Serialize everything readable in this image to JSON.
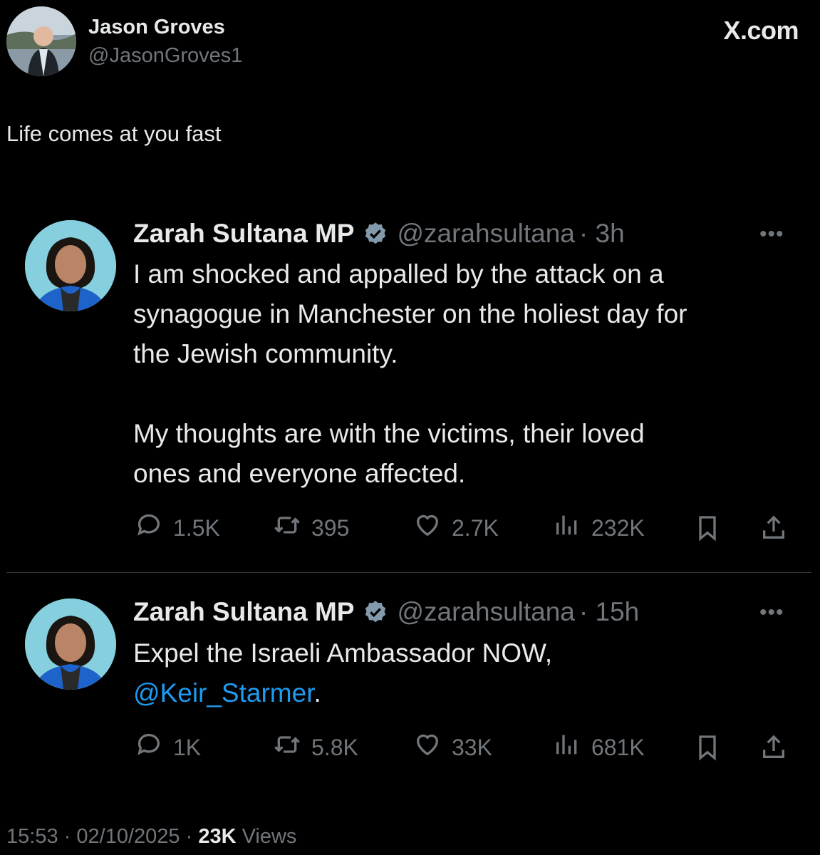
{
  "author": {
    "name": "Jason Groves",
    "handle": "@JasonGroves1"
  },
  "brand": "X.com",
  "post_text": "Life comes at you fast",
  "tweets": [
    {
      "name": "Zarah Sultana MP",
      "handle": "@zarahsultana",
      "time": "· 3h",
      "more": "•••",
      "lines": [
        "I am shocked and appalled by the attack on a",
        "synagogue in Manchester on the holiest day for",
        "the Jewish community.",
        "",
        "My thoughts are with the victims, their loved",
        "ones and everyone affected."
      ],
      "stats": {
        "replies": "1.5K",
        "reposts": "395",
        "likes": "2.7K",
        "views": "232K"
      }
    },
    {
      "name": "Zarah Sultana MP",
      "handle": "@zarahsultana",
      "time": "· 15h",
      "more": "•••",
      "line1": "Expel the Israeli Ambassador NOW,",
      "mention": "@Keir_Starmer",
      "mention_suffix": ".",
      "stats": {
        "replies": "1K",
        "reposts": "5.8K",
        "likes": "33K",
        "views": "681K"
      }
    }
  ],
  "footer": {
    "time": "15:53",
    "sep": "·",
    "date": "02/10/2025",
    "views_count": "23K",
    "views_label": "Views"
  },
  "colors": {
    "background": "#000000",
    "text": "#e7e9ea",
    "muted": "#71767b",
    "link": "#1d9bf0",
    "badge": "#829aab"
  },
  "icons": [
    "reply-icon",
    "repost-icon",
    "like-icon",
    "views-icon",
    "bookmark-icon",
    "share-icon",
    "verified-badge-icon"
  ]
}
